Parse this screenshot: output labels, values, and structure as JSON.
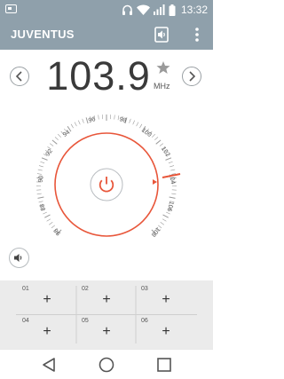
{
  "status_bar": {
    "time": "13:32",
    "icons": [
      "radio-icon",
      "headset-icon",
      "wifi-icon",
      "signal-icon",
      "battery-icon"
    ]
  },
  "app_bar": {
    "title": "JUVENTUS",
    "icons": [
      "speaker-output-icon",
      "more-options-icon"
    ]
  },
  "tuner": {
    "frequency": "103.9",
    "unit": "MHz",
    "favorite_icon": "star-icon",
    "prev_icon": "chevron-left-icon",
    "next_icon": "chevron-right-icon"
  },
  "dial": {
    "labels": [
      "94",
      "96",
      "98",
      "100",
      "102",
      "104",
      "106",
      "108",
      "90",
      "88",
      "92",
      "98"
    ],
    "power_icon": "power-icon",
    "accent_color": "#e8563a",
    "current_freq_mhz": 103.9
  },
  "volume": {
    "icon": "volume-icon"
  },
  "presets": [
    {
      "number": "01",
      "label": "+"
    },
    {
      "number": "02",
      "label": "+"
    },
    {
      "number": "03",
      "label": "+"
    },
    {
      "number": "04",
      "label": "+"
    },
    {
      "number": "05",
      "label": "+"
    },
    {
      "number": "06",
      "label": "+"
    }
  ],
  "nav_bar": {
    "icons": [
      "back-icon",
      "home-icon",
      "recents-icon"
    ]
  }
}
